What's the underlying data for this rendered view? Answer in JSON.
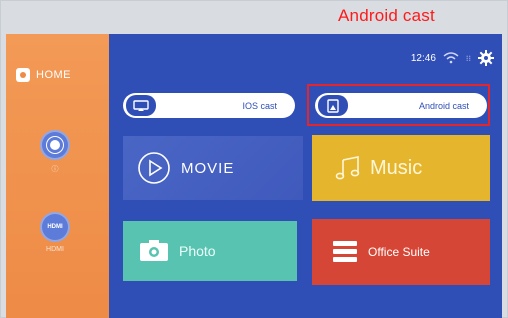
{
  "annotation": {
    "callout_text": "Android cast",
    "highlight_color": "#e3262c"
  },
  "sidebar": {
    "home_label": "HOME",
    "items": [
      {
        "icon": "settings-circle-icon",
        "caption": "ⓘ"
      },
      {
        "icon": "hdmi-icon",
        "badge": "HDMI",
        "caption": "HDMI"
      }
    ]
  },
  "status": {
    "time": "12:46",
    "network_chip": "⁝⁝"
  },
  "cast_buttons": {
    "ios": {
      "label": "IOS cast"
    },
    "android": {
      "label": "Android cast"
    }
  },
  "tiles": {
    "movie": {
      "label": "MOVIE",
      "color": "#4a66c5"
    },
    "music": {
      "label": "Music",
      "color": "#e5b62d"
    },
    "photo": {
      "label": "Photo",
      "color": "#59c3b1"
    },
    "office": {
      "label": "Office Suite",
      "color": "#d64636"
    }
  },
  "colors": {
    "background": "#2f4fb7",
    "sidebar": "#ee8b46"
  }
}
